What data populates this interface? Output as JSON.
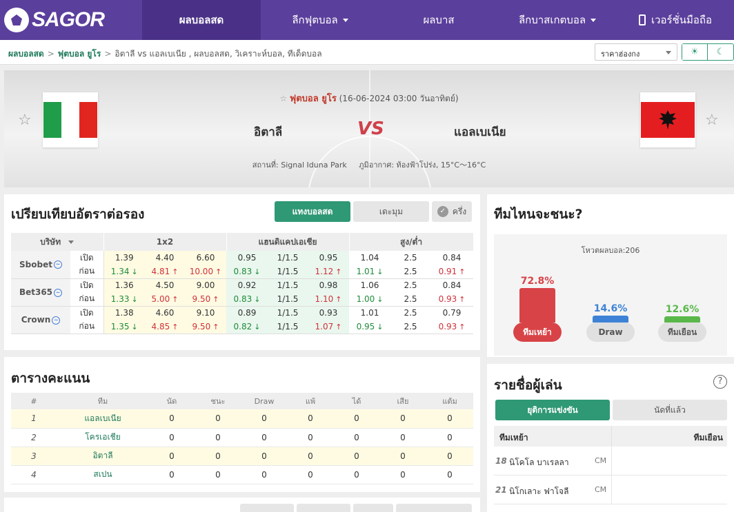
{
  "nav": {
    "logo": "SAGOR",
    "items": [
      {
        "label": "ผลบอลสด",
        "active": true,
        "dropdown": false
      },
      {
        "label": "ลีกฟุตบอล",
        "active": false,
        "dropdown": true
      },
      {
        "label": "ผลบาส",
        "active": false,
        "dropdown": false
      },
      {
        "label": "ลีกบาสเกตบอล",
        "active": false,
        "dropdown": true
      },
      {
        "label": "เวอร์ชั่นมือถือ",
        "active": false,
        "dropdown": false
      }
    ]
  },
  "breadcrumb": {
    "home": "ผลบอลสด",
    "league": "ฟุตบอล ยูโร",
    "current": "อิตาลี vs แอลเบเนีย , ผลบอลสด, วิเคราะห์บอล, ทีเด็ดบอล"
  },
  "odds_format": "ราคาฮ่องกง",
  "match": {
    "league": "ฟุตบอล ยูโร",
    "datetime": "(16-06-2024 03:00 วันอาทิตย์)",
    "home": "อิตาลี",
    "away": "แอลเบเนีย",
    "vs": "VS",
    "venue": "สถานที่: Signal Iduna Park",
    "weather": "ภูมิอากาศ: ท้องฟ้าโปร่ง, 15°C～16°C",
    "home_flag_colors": [
      "#1f9d48",
      "#ffffff",
      "#e0261f"
    ],
    "away_flag_color": "#e41e20"
  },
  "odds": {
    "title": "เปรียบเทียบอัตราต่อรอง",
    "buttons": {
      "live": "แทงบอลสด",
      "more": "เดะมุม",
      "half": "ครึ่ง"
    },
    "headers": {
      "company": "บริษัท",
      "x12": "1x2",
      "hdp": "แฮนดิแคปเอเชีย",
      "ou": "สูง/ต่ำ"
    },
    "labels": {
      "open": "เปิด",
      "before": "ก่อน"
    },
    "rows": [
      {
        "company": "Sbobet",
        "open": {
          "x12": [
            "1.39",
            "4.40",
            "6.60"
          ],
          "hdp": [
            "0.95",
            "1/1.5",
            "0.95"
          ],
          "ou": [
            "1.04",
            "2.5",
            "0.84"
          ]
        },
        "before": {
          "x12": [
            [
              "1.34",
              "down"
            ],
            [
              "4.81",
              "up"
            ],
            [
              "10.00",
              "up"
            ]
          ],
          "hdp": [
            [
              "0.83",
              "down"
            ],
            [
              "1/1.5",
              ""
            ],
            [
              "1.12",
              "up"
            ]
          ],
          "ou": [
            [
              "1.01",
              "down"
            ],
            [
              "2.5",
              ""
            ],
            [
              "0.91",
              "up"
            ]
          ]
        }
      },
      {
        "company": "Bet365",
        "open": {
          "x12": [
            "1.36",
            "4.50",
            "9.00"
          ],
          "hdp": [
            "0.92",
            "1/1.5",
            "0.98"
          ],
          "ou": [
            "1.06",
            "2.5",
            "0.84"
          ]
        },
        "before": {
          "x12": [
            [
              "1.33",
              "down"
            ],
            [
              "5.00",
              "up"
            ],
            [
              "9.50",
              "up"
            ]
          ],
          "hdp": [
            [
              "0.83",
              "down"
            ],
            [
              "1/1.5",
              ""
            ],
            [
              "1.10",
              "up"
            ]
          ],
          "ou": [
            [
              "1.00",
              "down"
            ],
            [
              "2.5",
              ""
            ],
            [
              "0.93",
              "up"
            ]
          ]
        }
      },
      {
        "company": "Crown",
        "open": {
          "x12": [
            "1.38",
            "4.60",
            "9.10"
          ],
          "hdp": [
            "0.89",
            "1/1.5",
            "0.93"
          ],
          "ou": [
            "1.01",
            "2.5",
            "0.79"
          ]
        },
        "before": {
          "x12": [
            [
              "1.35",
              "down"
            ],
            [
              "4.85",
              "up"
            ],
            [
              "9.50",
              "up"
            ]
          ],
          "hdp": [
            [
              "0.82",
              "down"
            ],
            [
              "1/1.5",
              ""
            ],
            [
              "1.07",
              "up"
            ]
          ],
          "ou": [
            [
              "0.95",
              "down"
            ],
            [
              "2.5",
              ""
            ],
            [
              "0.93",
              "up"
            ]
          ]
        }
      }
    ]
  },
  "vote": {
    "title": "ทีมไหนจะชนะ?",
    "count": "โหวตผลบอล:206",
    "options": [
      {
        "pct": "72.8%",
        "value": 72.8,
        "label": "ทีมเหย้า",
        "color": "#d84347",
        "label_bg": "#d84347",
        "label_fg": "#ffffff"
      },
      {
        "pct": "14.6%",
        "value": 14.6,
        "label": "Draw",
        "color": "#3d82d6",
        "label_bg": "#e0e0e0",
        "label_fg": "#555555"
      },
      {
        "pct": "12.6%",
        "value": 12.6,
        "label": "ทีมเยือน",
        "color": "#5ab84a",
        "label_bg": "#e0e0e0",
        "label_fg": "#555555"
      }
    ]
  },
  "standings": {
    "title": "ตารางคะแนน",
    "headers": [
      "#",
      "ทีม",
      "นัด",
      "ชนะ",
      "Draw",
      "แพ้",
      "ได้",
      "เสีย",
      "แต้ม"
    ],
    "rows": [
      {
        "cells": [
          "1",
          "แอลเบเนีย",
          "0",
          "0",
          "0",
          "0",
          "0",
          "0",
          "0"
        ],
        "hl": true
      },
      {
        "cells": [
          "2",
          "โครเอเชีย",
          "0",
          "0",
          "0",
          "0",
          "0",
          "0",
          "0"
        ],
        "hl": false
      },
      {
        "cells": [
          "3",
          "อิตาลี",
          "0",
          "0",
          "0",
          "0",
          "0",
          "0",
          "0"
        ],
        "hl": true
      },
      {
        "cells": [
          "4",
          "สเปน",
          "0",
          "0",
          "0",
          "0",
          "0",
          "0",
          "0"
        ],
        "hl": false
      }
    ]
  },
  "players": {
    "title": "รายชื่อผู้เล่น",
    "help": "?",
    "tabs": [
      "ยุติการแข่งขัน",
      "นัดที่แล้ว"
    ],
    "home_label": "ทีมเหย้า",
    "away_label": "ทีมเยือน",
    "rows": [
      {
        "num": "18",
        "name": "นิโคโล บาเรลลา",
        "pos": "CM"
      },
      {
        "num": "21",
        "name": "นิโกเลาะ ฟาโจลี",
        "pos": "CM"
      }
    ]
  }
}
